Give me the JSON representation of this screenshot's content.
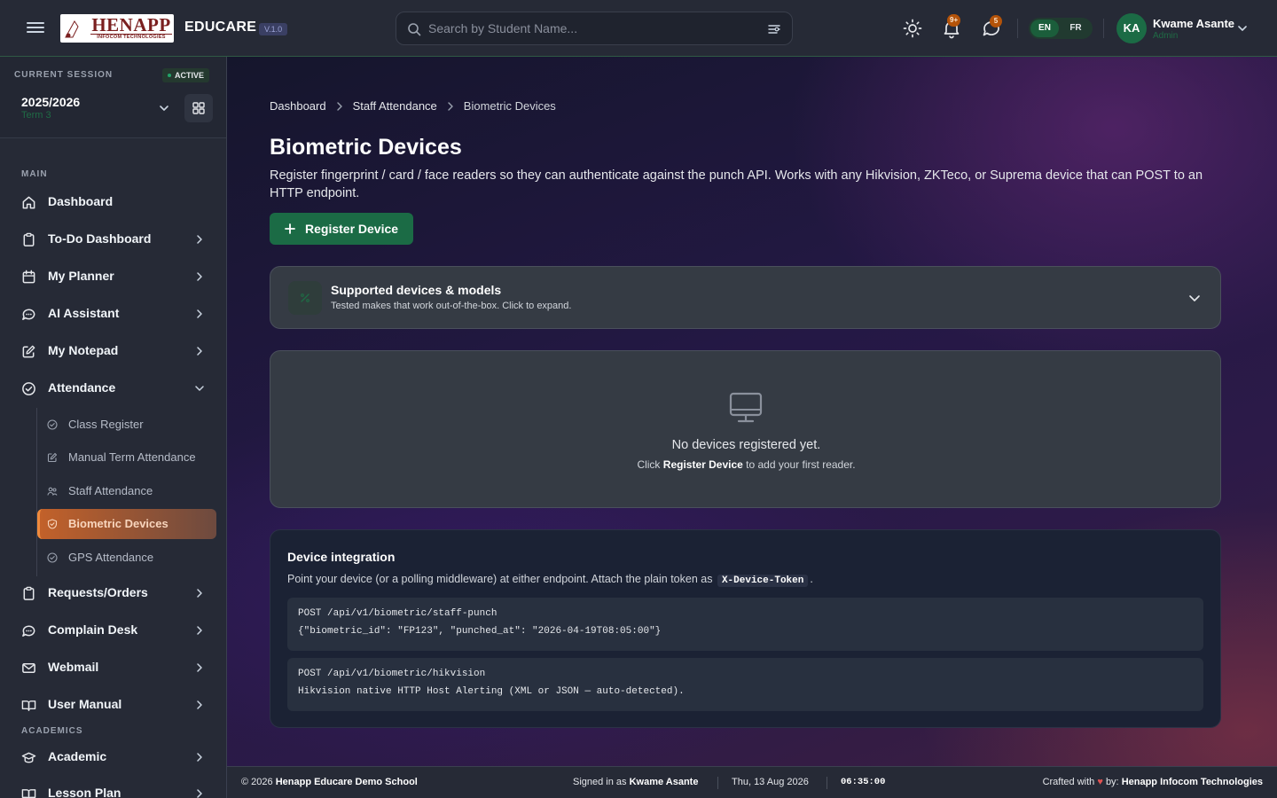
{
  "header": {
    "logo_text": "HENAPP",
    "logo_subtext": "INFOCOM TECHNOLOGIES",
    "brand": "EDUCARE",
    "version": "V.1.0",
    "search_placeholder": "Search by Student Name...",
    "notifications_badge": "9+",
    "messages_badge": "5",
    "languages": [
      "EN",
      "FR"
    ],
    "active_language": "EN",
    "user": {
      "initials": "KA",
      "name": "Kwame Asante",
      "role": "Admin"
    }
  },
  "sidebar": {
    "session_label": "CURRENT SESSION",
    "session_status": "ACTIVE",
    "session_year": "2025/2026",
    "session_term": "Term 3",
    "main_section": "MAIN",
    "academics_section": "ACADEMICS",
    "items": [
      {
        "label": "Dashboard",
        "icon": "home-icon"
      },
      {
        "label": "To-Do Dashboard",
        "icon": "clipboard-icon"
      },
      {
        "label": "My Planner",
        "icon": "calendar-icon"
      },
      {
        "label": "AI Assistant",
        "icon": "chat-bubble-icon"
      },
      {
        "label": "My Notepad",
        "icon": "edit-icon"
      },
      {
        "label": "Attendance",
        "icon": "check-circle-icon"
      },
      {
        "label": "Requests/Orders",
        "icon": "clipboard-icon"
      },
      {
        "label": "Complain Desk",
        "icon": "chat-bubble-icon"
      },
      {
        "label": "Webmail",
        "icon": "mail-icon"
      },
      {
        "label": "User Manual",
        "icon": "book-icon"
      },
      {
        "label": "Academic",
        "icon": "graduation-cap-icon"
      },
      {
        "label": "Lesson Plan",
        "icon": "book-icon"
      }
    ],
    "attendance_sub": [
      {
        "label": "Class Register"
      },
      {
        "label": "Manual Term Attendance"
      },
      {
        "label": "Staff Attendance"
      },
      {
        "label": "Biometric Devices"
      },
      {
        "label": "GPS Attendance"
      }
    ]
  },
  "main": {
    "breadcrumb": [
      "Dashboard",
      "Staff Attendance",
      "Biometric Devices"
    ],
    "title": "Biometric Devices",
    "description": "Register fingerprint / card / face readers so they can authenticate against the punch API. Works with any Hikvision, ZKTeco, or Suprema device that can POST to an HTTP endpoint.",
    "register_button": "Register Device",
    "supported": {
      "title": "Supported devices & models",
      "subtitle": "Tested makes that work out-of-the-box. Click to expand."
    },
    "empty": {
      "title": "No devices registered yet.",
      "sub_before": "Click ",
      "sub_bold": "Register Device",
      "sub_after": " to add your first reader."
    },
    "integration": {
      "title": "Device integration",
      "desc_before": "Point your device (or a polling middleware) at either endpoint. Attach the plain token as",
      "token": "X-Device-Token",
      "desc_after": ".",
      "endpoints": [
        {
          "line1": "POST /api/v1/biometric/staff-punch",
          "line2": "{\"biometric_id\": \"FP123\", \"punched_at\": \"2026-04-19T08:05:00\"}"
        },
        {
          "line1": "POST /api/v1/biometric/hikvision",
          "line2": "Hikvision native HTTP Host Alerting (XML or JSON — auto-detected)."
        }
      ]
    }
  },
  "footer": {
    "copyright": "© 2026",
    "school": "Henapp Educare Demo School",
    "signed_in_prefix": "Signed in as",
    "signed_in_user": "Kwame Asante",
    "date": "Thu, 13 Aug 2026",
    "time": "06:35:00",
    "crafted_prefix": "Crafted with",
    "crafted_heart": "♥",
    "crafted_by": "by:",
    "company": "Henapp Infocom Technologies"
  },
  "colors": {
    "accent_green": "#1b6b45",
    "active_orange": "#c2612a",
    "topbar_bg": "#262a36"
  }
}
